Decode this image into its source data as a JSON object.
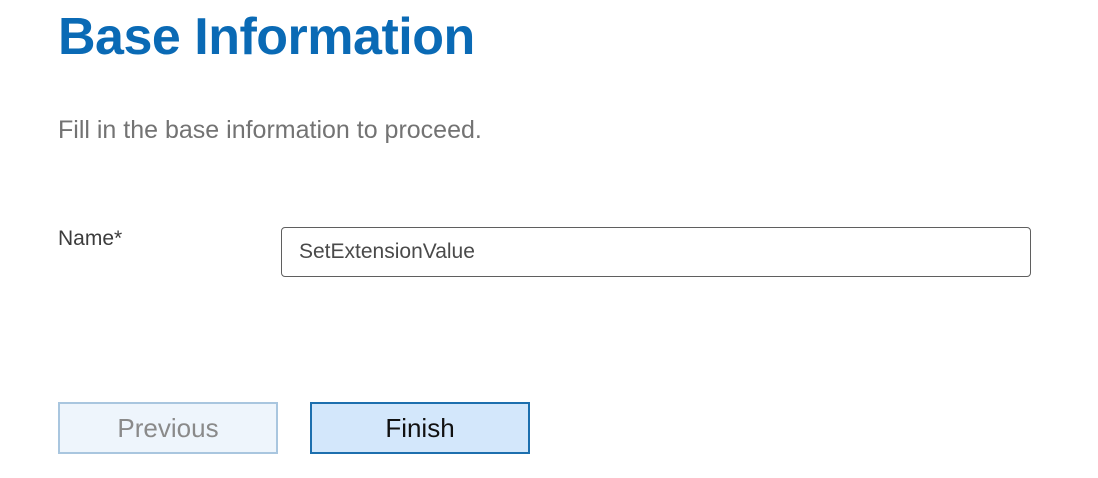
{
  "header": {
    "title": "Base Information",
    "subtitle": "Fill in the base information to proceed."
  },
  "form": {
    "name_field": {
      "label": "Name*",
      "value": "SetExtensionValue",
      "placeholder": ""
    }
  },
  "actions": {
    "previous_label": "Previous",
    "finish_label": "Finish"
  },
  "colors": {
    "title": "#0a6ab5",
    "finish_background": "#d3e7fb",
    "finish_border": "#1d6fae",
    "previous_background": "#eef5fc",
    "previous_border": "#a9c6df"
  }
}
